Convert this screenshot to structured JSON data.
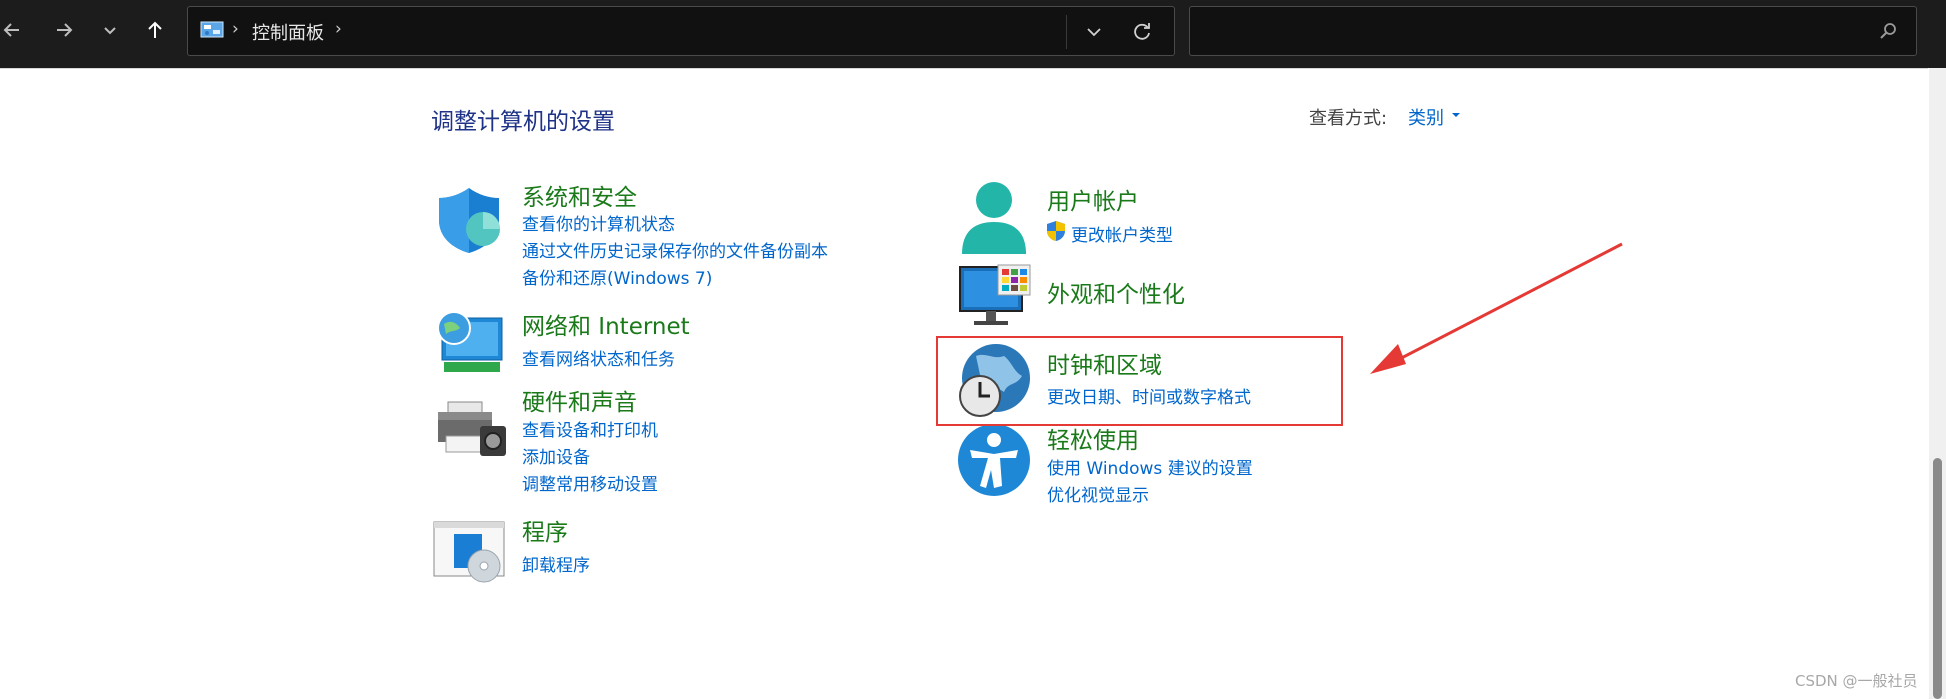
{
  "address_bar": {
    "breadcrumb": "控制面板",
    "separator": "›"
  },
  "search": {
    "placeholder": ""
  },
  "header": {
    "title": "调整计算机的设置",
    "view_by_label": "查看方式:",
    "view_by_value": "类别"
  },
  "categories": {
    "system_security": {
      "title": "系统和安全",
      "links": [
        "查看你的计算机状态",
        "通过文件历史记录保存你的文件备份副本",
        "备份和还原(Windows 7)"
      ]
    },
    "network": {
      "title": "网络和 Internet",
      "links": [
        "查看网络状态和任务"
      ]
    },
    "hardware": {
      "title": "硬件和声音",
      "links": [
        "查看设备和打印机",
        "添加设备",
        "调整常用移动设置"
      ]
    },
    "programs": {
      "title": "程序",
      "links": [
        "卸载程序"
      ]
    },
    "user_accounts": {
      "title": "用户帐户",
      "links": [
        "更改帐户类型"
      ]
    },
    "appearance": {
      "title": "外观和个性化",
      "links": []
    },
    "clock_region": {
      "title": "时钟和区域",
      "links": [
        "更改日期、时间或数字格式"
      ]
    },
    "ease_of_access": {
      "title": "轻松使用",
      "links": [
        "使用 Windows 建议的设置",
        "优化视觉显示"
      ]
    }
  },
  "watermark": "CSDN @一般社员",
  "colors": {
    "title_blue": "#1e3287",
    "category_green": "#1a7a1a",
    "link_blue": "#0066cc",
    "highlight_red": "#e53935"
  }
}
